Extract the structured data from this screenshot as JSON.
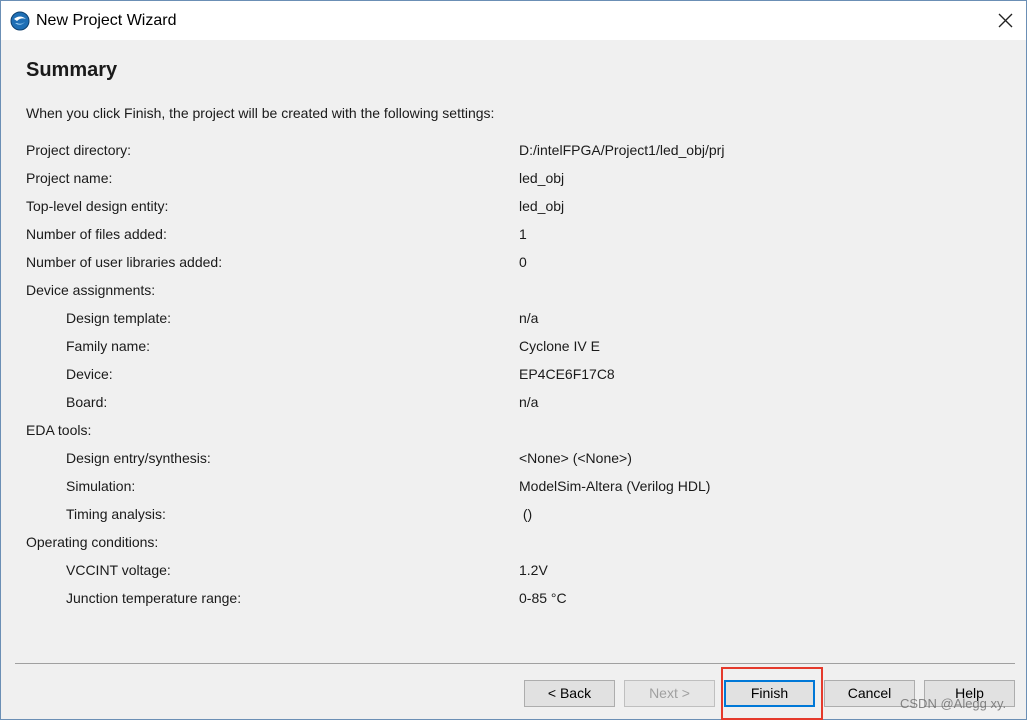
{
  "window": {
    "title": "New Project Wizard",
    "icon": "quartus-app-icon"
  },
  "page": {
    "heading": "Summary",
    "intro": "When you click Finish, the project will be created with the following settings:"
  },
  "settings": [
    {
      "label": "Project directory:",
      "value": "D:/intelFPGA/Project1/led_obj/prj",
      "indent": false
    },
    {
      "label": "Project name:",
      "value": "led_obj",
      "indent": false
    },
    {
      "label": "Top-level design entity:",
      "value": "led_obj",
      "indent": false
    },
    {
      "label": "Number of files added:",
      "value": "1",
      "indent": false
    },
    {
      "label": "Number of user libraries added:",
      "value": "0",
      "indent": false
    },
    {
      "label": "Device assignments:",
      "value": "",
      "indent": false
    },
    {
      "label": "Design template:",
      "value": "n/a",
      "indent": true
    },
    {
      "label": "Family name:",
      "value": "Cyclone IV E",
      "indent": true
    },
    {
      "label": "Device:",
      "value": "EP4CE6F17C8",
      "indent": true
    },
    {
      "label": "Board:",
      "value": "n/a",
      "indent": true
    },
    {
      "label": "EDA tools:",
      "value": "",
      "indent": false
    },
    {
      "label": "Design entry/synthesis:",
      "value": "<None> (<None>)",
      "indent": true
    },
    {
      "label": "Simulation:",
      "value": "ModelSim-Altera (Verilog HDL)",
      "indent": true
    },
    {
      "label": "Timing analysis:",
      "value": " ()",
      "indent": true
    },
    {
      "label": "Operating conditions:",
      "value": "",
      "indent": false
    },
    {
      "label": "VCCINT voltage:",
      "value": "1.2V",
      "indent": true
    },
    {
      "label": "Junction temperature range:",
      "value": "0-85 °C",
      "indent": true
    }
  ],
  "buttons": {
    "back": "< Back",
    "next": "Next >",
    "finish": "Finish",
    "cancel": "Cancel",
    "help": "Help"
  },
  "watermark": "CSDN @Alegg xy.",
  "colors": {
    "accent": "#0078d7",
    "highlight": "#e53a2c",
    "titlebar": "#ffffff",
    "background": "#f0f0f0"
  }
}
